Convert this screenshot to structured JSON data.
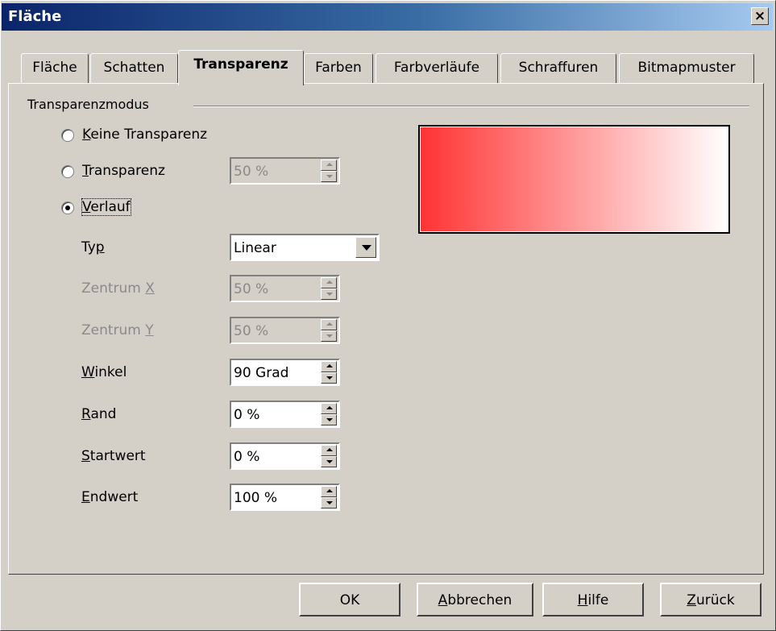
{
  "window": {
    "title": "Fläche",
    "close_label": "×"
  },
  "tabs": [
    {
      "label": "Fläche",
      "active": false
    },
    {
      "label": "Schatten",
      "active": false
    },
    {
      "label": "Transparenz",
      "active": true
    },
    {
      "label": "Farben",
      "active": false
    },
    {
      "label": "Farbverläufe",
      "active": false
    },
    {
      "label": "Schraffuren",
      "active": false
    },
    {
      "label": "Bitmapmuster",
      "active": false
    }
  ],
  "mode": {
    "group_label": "Transparenzmodus",
    "options": [
      {
        "label_access": "K",
        "label_rest": "eine Transparenz",
        "checked": false
      },
      {
        "label_access": "T",
        "label_rest": "ransparenz",
        "checked": false
      },
      {
        "label_access": "V",
        "label_rest": "erlauf",
        "checked": true
      }
    ],
    "transparency_value": "50 %"
  },
  "gradient": {
    "type_label": {
      "pre": "Ty",
      "access": "p",
      "post": ""
    },
    "type_value": "Linear",
    "center_x_label": {
      "pre": "Zentrum ",
      "access": "X"
    },
    "center_x_value": "50 %",
    "center_y_label": {
      "pre": "Zentrum ",
      "access": "Y"
    },
    "center_y_value": "50 %",
    "angle_label": {
      "access": "W",
      "rest": "inkel"
    },
    "angle_value": "90 Grad",
    "border_label": {
      "access": "R",
      "rest": "and"
    },
    "border_value": "0 %",
    "start_label": {
      "access": "S",
      "rest": "tartwert"
    },
    "start_value": "0 %",
    "end_label": {
      "access": "E",
      "rest": "ndwert"
    },
    "end_value": "100 %"
  },
  "preview": {
    "start_color": "#ff3333",
    "end_color": "#ffffff"
  },
  "buttons": {
    "ok": "OK",
    "cancel": {
      "access": "A",
      "rest": "bbrechen"
    },
    "help": {
      "access": "H",
      "rest": "ilfe"
    },
    "reset": {
      "access": "Z",
      "rest": "urück"
    }
  }
}
